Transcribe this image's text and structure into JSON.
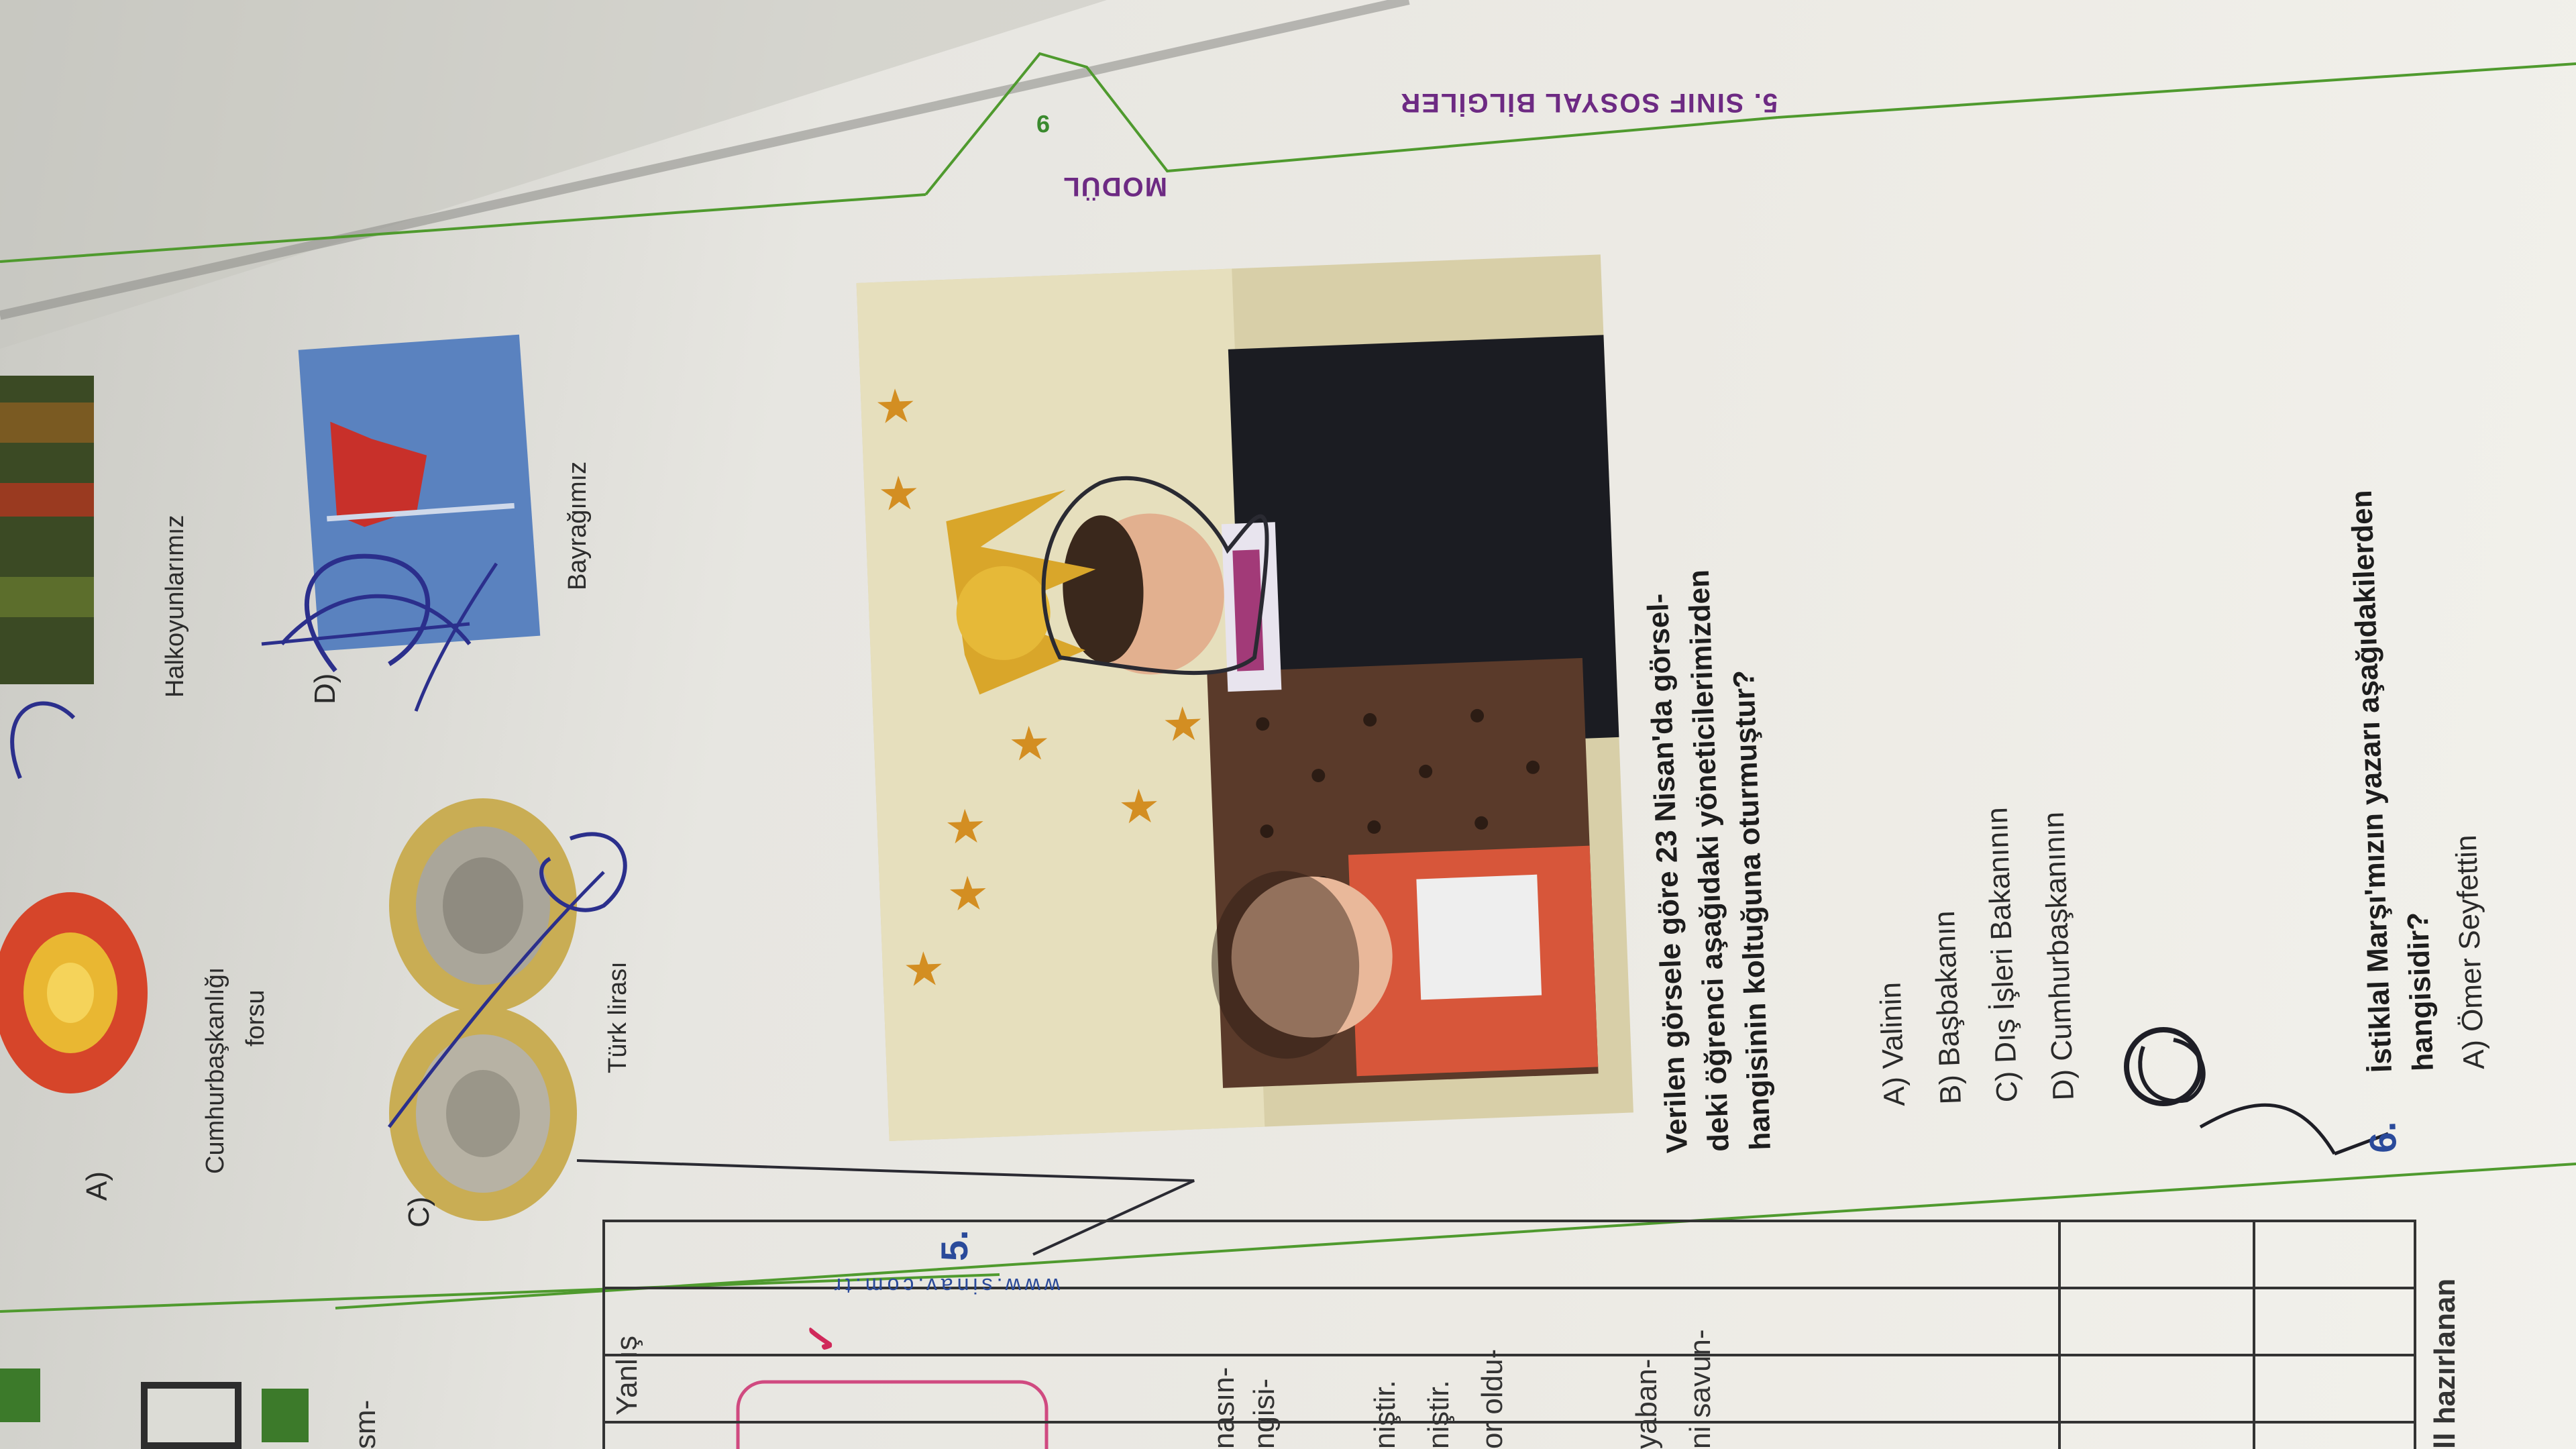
{
  "header": {
    "course": "5. SINIF SOSYAL BİLGİLER",
    "module_label": "MODÜL",
    "module_number": "9"
  },
  "website": "www.sinav.com.tr",
  "top_options": {
    "a_label": "A)",
    "a_caption": "Cumhurbaşkanlığı",
    "a_caption2": "forsu",
    "b_caption": "Halkoyunlarımız",
    "c_label": "C)",
    "c_caption": "Türk lirası",
    "d_label": "D)",
    "d_caption": "Bayrağımız"
  },
  "question5": {
    "number": "5.",
    "text_line1": "Verilen görsele göre 23 Nisan'da görsel-",
    "text_line2": "deki öğrenci aşağıdaki yöneticilerimizden",
    "text_line3": "hangisinin koltuğuna oturmuştur?",
    "options": [
      {
        "label": "A)",
        "text": "Valinin"
      },
      {
        "label": "B)",
        "text": "Başbakanın"
      },
      {
        "label": "C)",
        "text": "Dış İşleri Bakanının"
      },
      {
        "label": "D)",
        "text": "Cumhurbaşkanının"
      }
    ]
  },
  "question6": {
    "number": "6.",
    "text_line1": "İstiklal Marşı'mızın yazarı aşağıdakilerden",
    "text_line2": "hangisidir?",
    "option_a": "A) Ömer Seyfettin"
  },
  "left_column": {
    "fragments": [
      "nasın-",
      "ngisi-",
      "niştir.",
      "niştir.",
      "or oldu-",
      "yaban-",
      "ni savun-",
      "ll hazırlanan",
      "sm-"
    ],
    "table_header": "Yanlış",
    "check_mark": "✓"
  },
  "colors": {
    "modul_purple": "#6d2a83",
    "rule_green": "#4f9a2e",
    "question_blue": "#2a4a9a",
    "ink_blue": "#2b2f8c"
  }
}
